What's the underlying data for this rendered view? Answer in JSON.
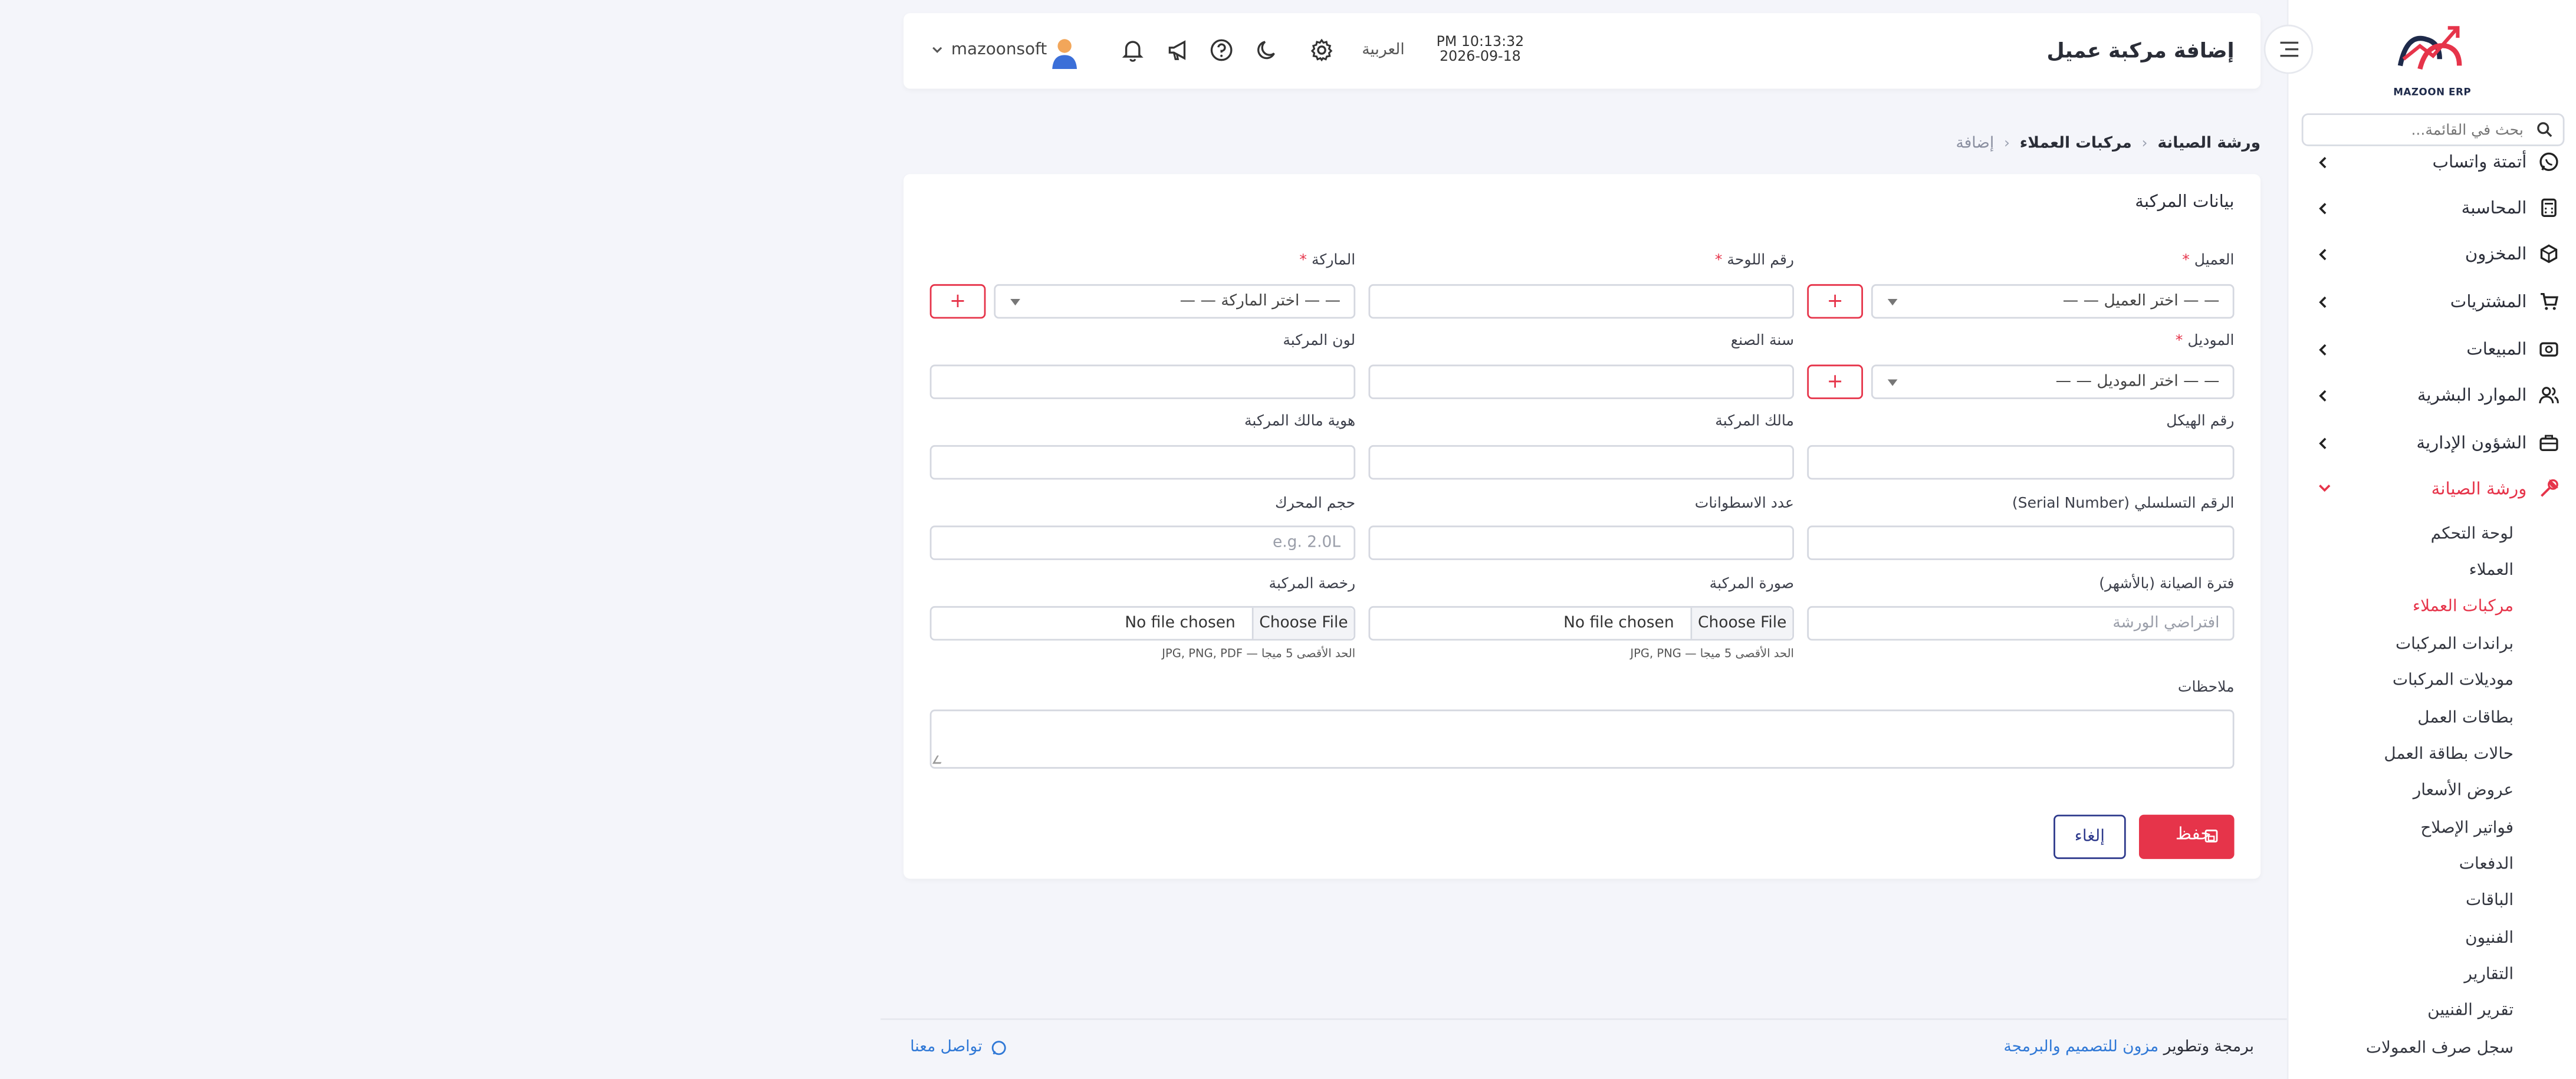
{
  "brand": {
    "name": "MAZOON ERP",
    "accent": "#e6344a"
  },
  "sidebar": {
    "search_placeholder": "بحث في القائمة...",
    "items": [
      {
        "label": "أتمتة واتساب",
        "icon": "whatsapp-icon"
      },
      {
        "label": "المحاسبة",
        "icon": "calculator-icon"
      },
      {
        "label": "المخزون",
        "icon": "box-icon"
      },
      {
        "label": "المشتريات",
        "icon": "cart-icon"
      },
      {
        "label": "المبيعات",
        "icon": "sales-icon"
      },
      {
        "label": "الموارد البشرية",
        "icon": "users-icon"
      },
      {
        "label": "الشؤون الإدارية",
        "icon": "briefcase-icon"
      },
      {
        "label": "ورشة الصيانة",
        "icon": "wrench-icon",
        "active": true
      }
    ],
    "subitems": [
      {
        "label": "لوحة التحكم"
      },
      {
        "label": "العملاء"
      },
      {
        "label": "مركبات العملاء",
        "active": true
      },
      {
        "label": "براندات المركبات"
      },
      {
        "label": "موديلات المركبات"
      },
      {
        "label": "بطاقات العمل"
      },
      {
        "label": "حالات بطاقة العمل"
      },
      {
        "label": "عروض الأسعار"
      },
      {
        "label": "فواتير الإصلاح"
      },
      {
        "label": "الدفعات"
      },
      {
        "label": "الباقات"
      },
      {
        "label": "الفنيون"
      },
      {
        "label": "التقارير"
      },
      {
        "label": "تقرير الفنيين"
      },
      {
        "label": "سجل صرف العمولات"
      }
    ]
  },
  "header": {
    "title": "إضافة مركبة عميل",
    "time": "PM 10:13:32",
    "date": "2026-09-18",
    "language": "العربية",
    "username": "mazoonsoft"
  },
  "breadcrumb": {
    "items": [
      "ورشة الصيانة",
      "مركبات العملاء",
      "إضافة"
    ],
    "separator": "‹"
  },
  "form": {
    "card_title": "بيانات المركبة",
    "customer": {
      "label": "العميل",
      "required": "*",
      "placeholder": "— — اختر العميل — —"
    },
    "plate": {
      "label": "رقم اللوحة",
      "required": "*"
    },
    "brand": {
      "label": "الماركة",
      "required": "*",
      "placeholder": "— — اختر الماركة — —"
    },
    "model": {
      "label": "الموديل",
      "required": "*",
      "placeholder": "— — اختر الموديل — —"
    },
    "year": {
      "label": "سنة الصنع"
    },
    "color": {
      "label": "لون المركبة"
    },
    "chassis": {
      "label": "رقم الهيكل"
    },
    "owner": {
      "label": "مالك المركبة"
    },
    "owner_id": {
      "label": "هوية مالك المركبة"
    },
    "serial": {
      "label": "الرقم التسلسلي (Serial Number)"
    },
    "cylinders": {
      "label": "عدد الاسطوانات"
    },
    "engine": {
      "label": "حجم المحرك",
      "placeholder": "e.g. 2.0L"
    },
    "maintenance_period": {
      "label": "فترة الصيانة (بالأشهر)",
      "placeholder": "افتراضي الورشة"
    },
    "photo": {
      "label": "صورة المركبة",
      "choose": "Choose File",
      "no_file": "No file chosen",
      "hint": "الحد الأقصى 5 ميجا — JPG, PNG"
    },
    "license": {
      "label": "رخصة المركبة",
      "choose": "Choose File",
      "no_file": "No file chosen",
      "hint": "الحد الأقصى 5 ميجا — JPG, PNG, PDF"
    },
    "notes": {
      "label": "ملاحظات"
    },
    "plus": "+",
    "save": "حفظ",
    "cancel": "إلغاء"
  },
  "footer": {
    "credit_prefix": "برمجة وتطوير",
    "credit_link": "مزون للتصميم والبرمجة",
    "contact": "تواصل معنا"
  }
}
